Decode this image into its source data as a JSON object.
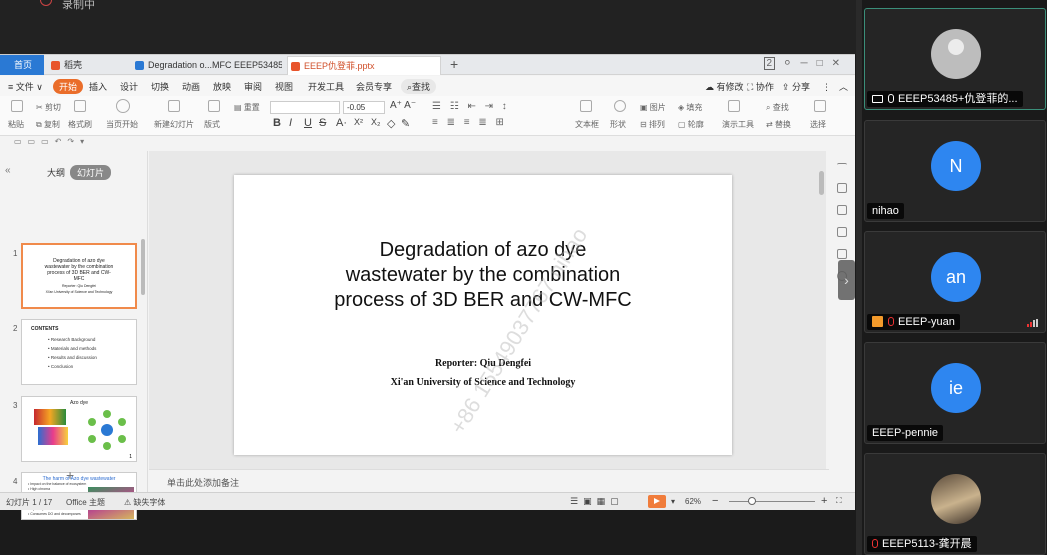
{
  "top_strip": {
    "label": "录制中"
  },
  "wps": {
    "tabs": [
      {
        "label": "首页"
      },
      {
        "label": "稻壳"
      },
      {
        "label": "Degradation o...MFC EEEP53485"
      },
      {
        "label": "EEEP仇登菲.pptx"
      }
    ],
    "window_badge": "2",
    "menu": {
      "file": "≡ 文件 ∨",
      "items": [
        "开始",
        "插入",
        "设计",
        "切换",
        "动画",
        "放映",
        "审阅",
        "视图",
        "开发工具",
        "会员专享"
      ],
      "search": "查找",
      "right": [
        "有修改",
        "协作",
        "分享"
      ]
    },
    "ribbon": {
      "paste": "粘贴",
      "cut": "剪切",
      "copy": "复制",
      "format_painter": "格式刷",
      "play_from_current": "当页开始",
      "new_slide": "新建幻灯片",
      "layout": "版式",
      "reset": "重置",
      "font_size": "-0.05",
      "textbox": "文本框",
      "shape": "形状",
      "arrange": "排列",
      "outline": "轮廓",
      "image": "图片",
      "fill": "填充",
      "find": "查找",
      "replace": "替换",
      "present_tools": "演示工具",
      "select": "选择"
    },
    "left_panel": {
      "outline_tab": "大纲",
      "slides_tab": "幻灯片",
      "thumbs": [
        {
          "num": "1",
          "title": "Degradation of azo dye wastewater by the combination process of 3D BER and CW-MFC",
          "sub1": "Reporter: Qiu Dengfei",
          "sub2": "Xi'an University of Science and Technology"
        },
        {
          "num": "2",
          "title": "CONTENTS",
          "items": [
            "Research Background",
            "Materials and methods",
            "Results and discussion",
            "Conclusion"
          ]
        },
        {
          "num": "3",
          "title": "Azo dye",
          "page": "1"
        },
        {
          "num": "4",
          "title": "The harm of Azo dye wastewater",
          "items": [
            "Impact on the balance of ecosystem",
            "High chroma",
            "Absorb visible light",
            "Transparency of water bodies reduced",
            "The photosynthesis of aquatic",
            "aquatic plants inhibited",
            "Consumes DO and decomposes"
          ]
        }
      ]
    },
    "slide": {
      "title_lines": [
        "Degradation of azo dye",
        "wastewater by the combination",
        "process of 3D BER and CW-MFC"
      ],
      "reporter": "Reporter: Qiu Dengfei",
      "university": "Xi'an University of Science and Technology",
      "watermark": "+86 15549037767 nihao"
    },
    "notes_placeholder": "单击此处添加备注",
    "status": {
      "slide_indicator": "幻灯片 1 / 17",
      "theme": "Office 主题",
      "missing_font": "缺失字体",
      "zoom": "62%"
    }
  },
  "participants": [
    {
      "name": "EEEP53485+仇登菲的...",
      "initials": "",
      "kind": "gray",
      "sharing": true
    },
    {
      "name": "nihao",
      "initials": "N",
      "kind": "blue"
    },
    {
      "name": "EEEP-yuan",
      "initials": "an",
      "kind": "blue",
      "host": true
    },
    {
      "name": "EEEP-pennie",
      "initials": "ie",
      "kind": "blue"
    },
    {
      "name": "EEEP5113-龚开晨",
      "initials": "",
      "kind": "photo"
    }
  ],
  "colors": {
    "accent": "#2e86f0",
    "wps_orange": "#ea6d2a",
    "tab_blue": "#2a79d4"
  }
}
